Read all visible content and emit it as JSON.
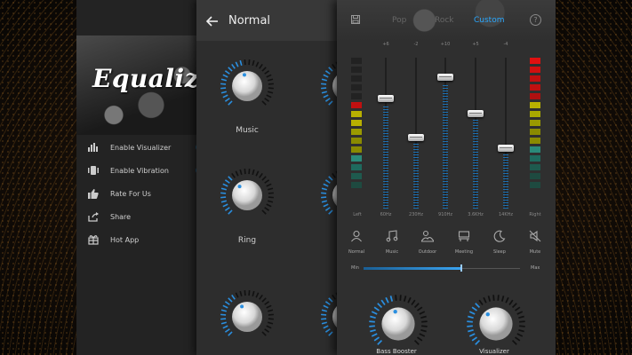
{
  "drawer": {
    "title": "Equalizer",
    "items": [
      {
        "label": "Enable Visualizer",
        "icon": "visualizer-bars-icon"
      },
      {
        "label": "Enable Vibration",
        "icon": "vibration-icon"
      },
      {
        "label": "Rate For Us",
        "icon": "thumbs-up-icon"
      },
      {
        "label": "Share",
        "icon": "share-icon"
      },
      {
        "label": "Hot App",
        "icon": "hot-app-icon"
      }
    ]
  },
  "normal_screen": {
    "title": "Normal",
    "knobs": [
      {
        "label": "Music"
      },
      {
        "label": "Ring"
      },
      {
        "label": ""
      }
    ],
    "accent": "#2a8fe0"
  },
  "custom_screen": {
    "tabs": [
      {
        "label": "Pop",
        "active": false
      },
      {
        "label": "Rock",
        "active": false
      },
      {
        "label": "Custom",
        "active": true
      }
    ],
    "active_color": "#2aa8ff",
    "meters": {
      "left_label": "Left",
      "right_label": "Right"
    },
    "bands": [
      {
        "top": "+6",
        "label": "60Hz",
        "level": 0.73
      },
      {
        "top": "-2",
        "label": "230Hz",
        "level": 0.47
      },
      {
        "top": "+10",
        "label": "910Hz",
        "level": 0.87
      },
      {
        "top": "+5",
        "label": "3.6KHz",
        "level": 0.63
      },
      {
        "top": "-4",
        "label": "14KHz",
        "level": 0.4
      }
    ],
    "presets": [
      {
        "label": "Normal",
        "icon": "person-icon"
      },
      {
        "label": "Music",
        "icon": "music-note-icon"
      },
      {
        "label": "Outdoor",
        "icon": "outdoor-icon"
      },
      {
        "label": "Meeting",
        "icon": "meeting-icon"
      },
      {
        "label": "Sleep",
        "icon": "moon-icon"
      },
      {
        "label": "Mute",
        "icon": "mute-icon"
      }
    ],
    "range": {
      "min_label": "Min",
      "max_label": "Max",
      "value": 0.62
    },
    "knobs": [
      {
        "label": "Bass Booster"
      },
      {
        "label": "Visualizer"
      }
    ]
  }
}
